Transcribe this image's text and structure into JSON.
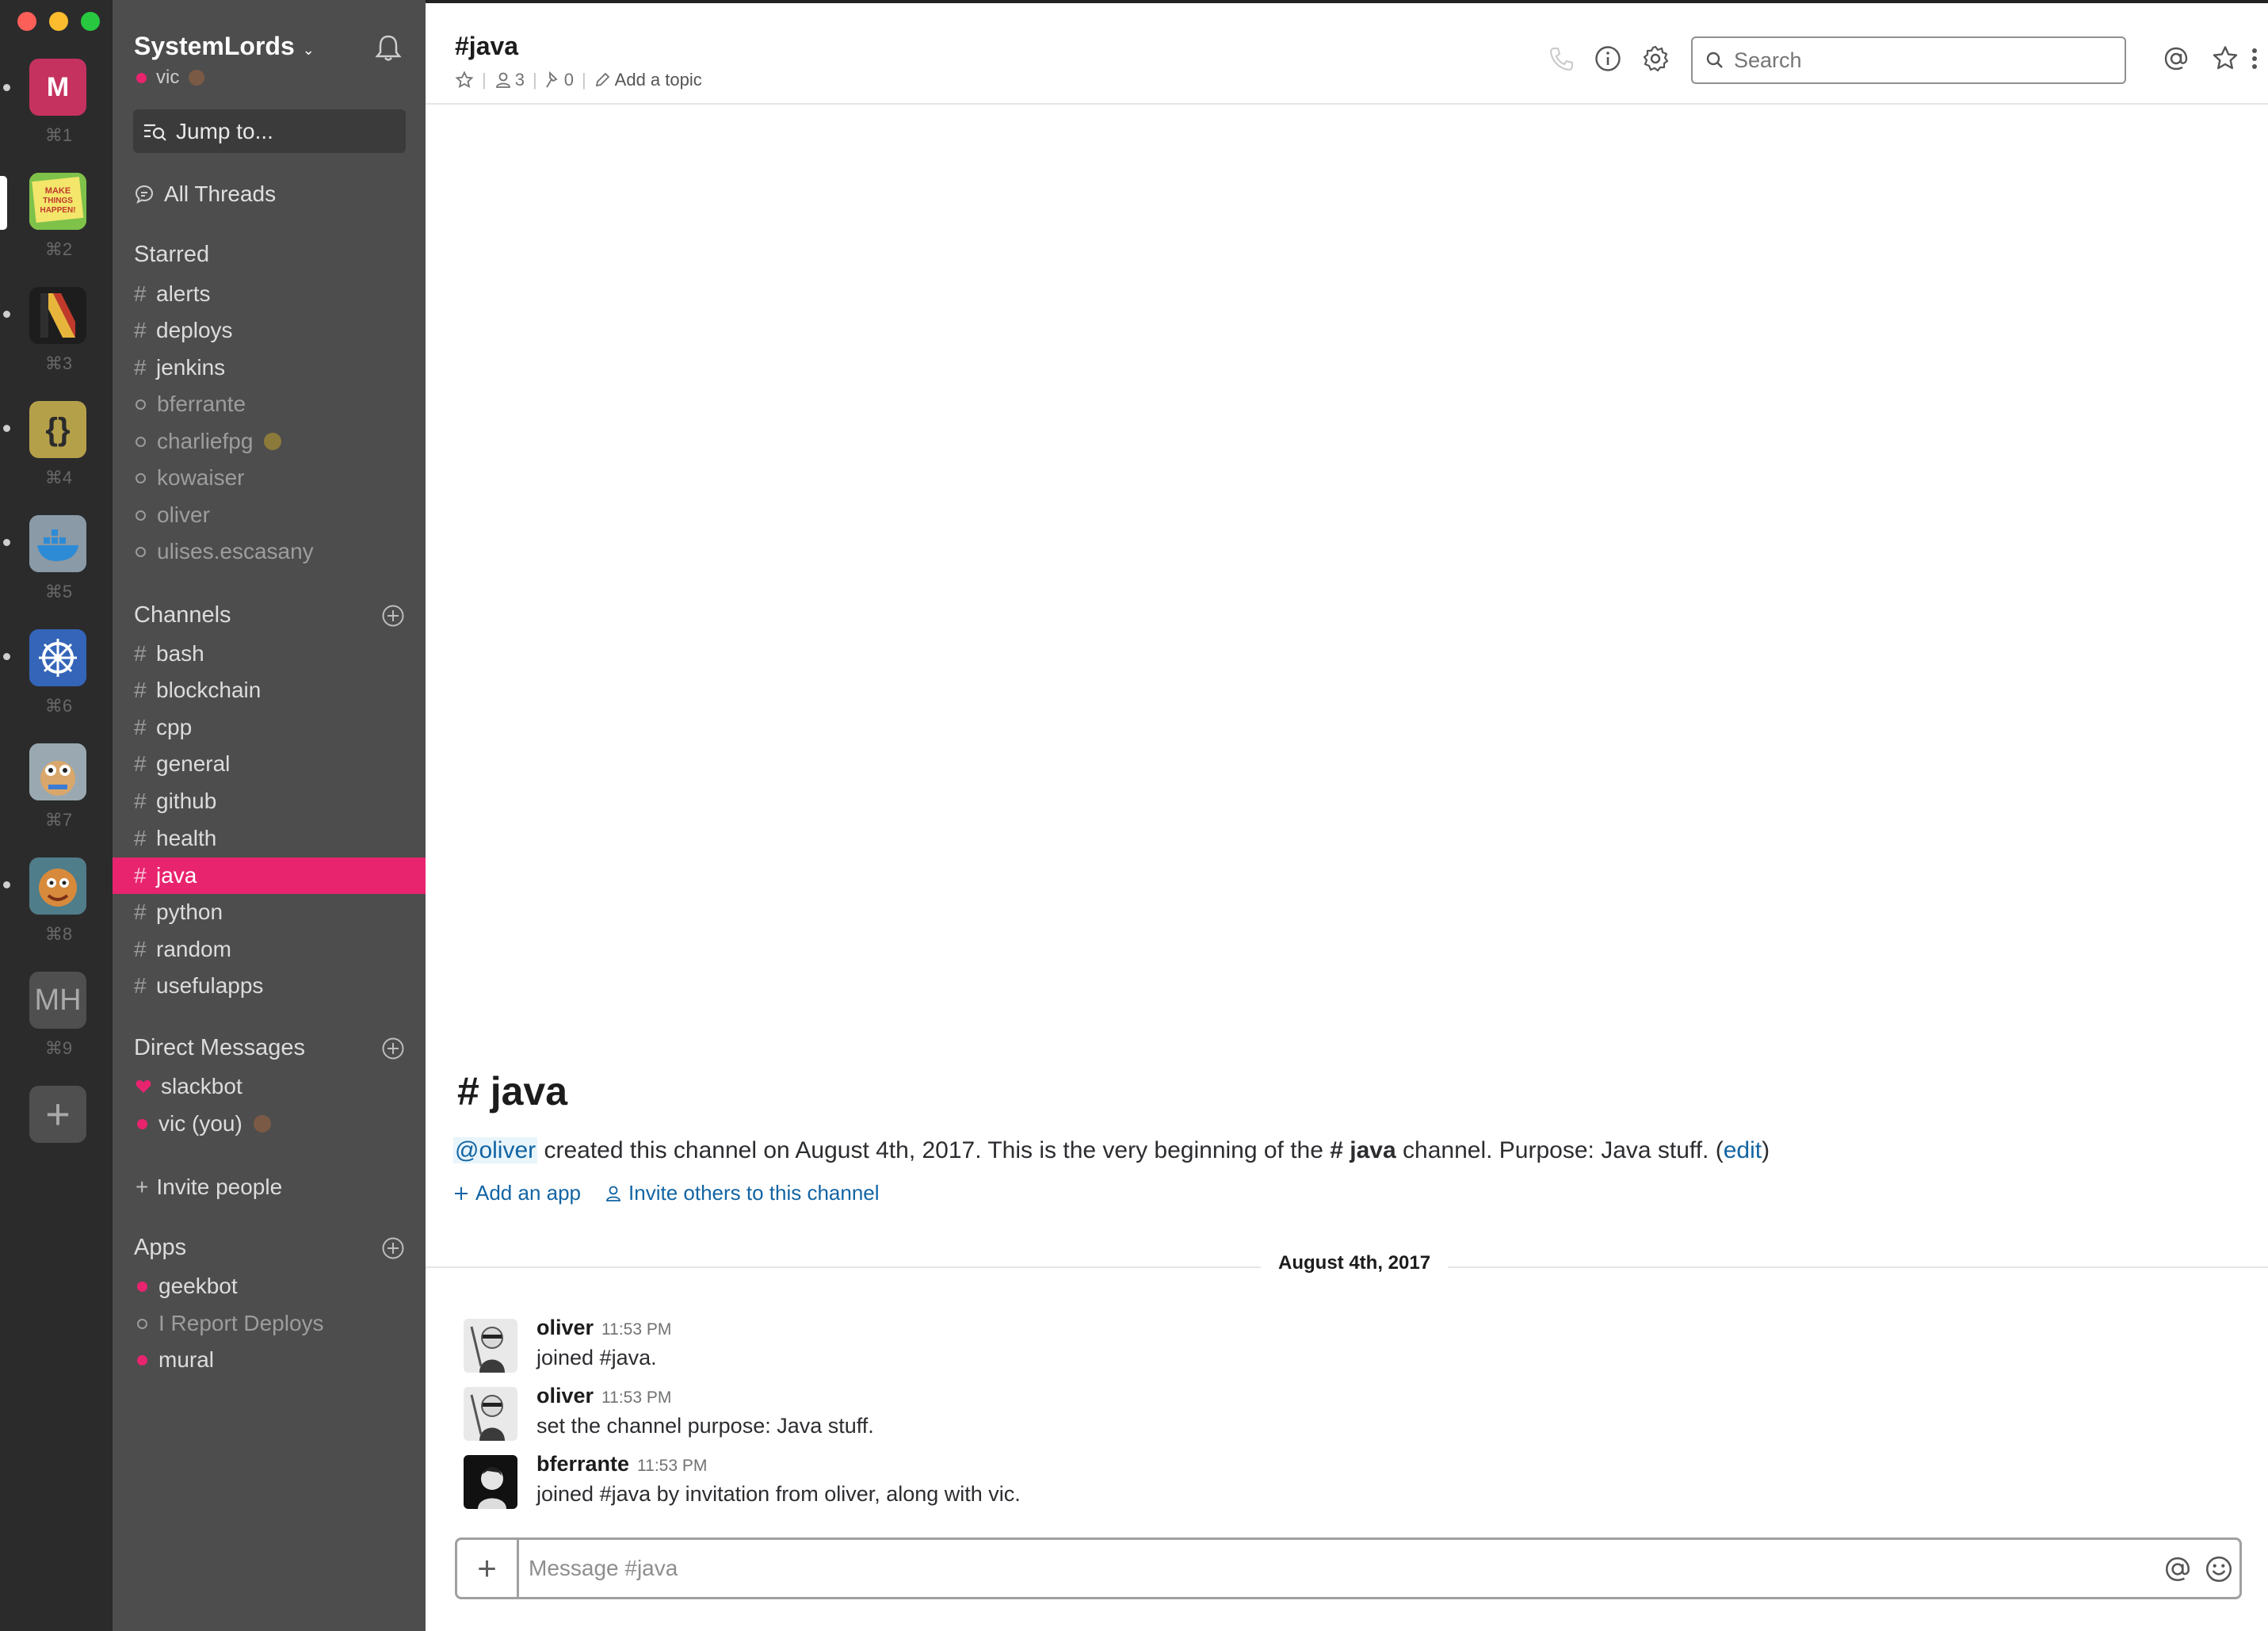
{
  "colors": {
    "accent": "#e8246f",
    "sidebar": "#4d4d4d",
    "teams_bar": "#2b2b2c",
    "link": "#1264a3"
  },
  "teams": [
    {
      "initials": "M",
      "key": "⌘1",
      "color": "#c6325f"
    },
    {
      "initials": "",
      "key": "⌘2",
      "color": "#e9d84a",
      "art": "make-things-happen"
    },
    {
      "initials": "",
      "key": "⌘3",
      "color": "#222",
      "art": "n-logo"
    },
    {
      "initials": "{}",
      "key": "⌘4",
      "color": "#b5a04a"
    },
    {
      "initials": "",
      "key": "⌘5",
      "color": "#7c8f9c",
      "art": "whale"
    },
    {
      "initials": "",
      "key": "⌘6",
      "color": "#3465b8",
      "art": "helm"
    },
    {
      "initials": "",
      "key": "⌘7",
      "color": "#8fa0a9",
      "art": "gopher"
    },
    {
      "initials": "",
      "key": "⌘8",
      "color": "#a26b3a",
      "art": "cartoon"
    },
    {
      "initials": "MH",
      "key": "⌘9",
      "color": "#4f4f50"
    }
  ],
  "add_team_label": "+",
  "sidebar": {
    "team_name": "SystemLords",
    "team_caret": "⌄",
    "username": "vic",
    "jump_to": "Jump to...",
    "all_threads": "All Threads",
    "starred": {
      "heading": "Starred",
      "channels": [
        "alerts",
        "deploys",
        "jenkins"
      ],
      "dms": [
        "bferrante",
        "charliefpg",
        "kowaiser",
        "oliver",
        "ulises.escasany"
      ]
    },
    "channels": {
      "heading": "Channels",
      "items": [
        "bash",
        "blockchain",
        "cpp",
        "general",
        "github",
        "health",
        "java",
        "python",
        "random",
        "usefulapps"
      ],
      "selected": "java"
    },
    "direct_messages": {
      "heading": "Direct Messages",
      "items": [
        "slackbot",
        "vic  (you)"
      ]
    },
    "invite": "Invite people",
    "apps": {
      "heading": "Apps",
      "items": [
        "geekbot",
        "I Report Deploys",
        "mural"
      ]
    }
  },
  "header": {
    "title": "#java",
    "members": "3",
    "pins": "0",
    "topic": "Add a topic",
    "search_placeholder": "Search"
  },
  "intro": {
    "title": "# java",
    "mention": "@oliver",
    "text_1": " created this channel on August 4th, 2017. This is the very beginning of the ",
    "channel": " # java",
    "text_2": " channel. Purpose: Java stuff. (",
    "edit": "edit",
    "text_3": ")",
    "add_app": "Add an app",
    "invite_others": "Invite others to this channel"
  },
  "day_divider": "August 4th, 2017",
  "messages": [
    {
      "name": "oliver",
      "time": "11:53 PM",
      "text": "joined #java."
    },
    {
      "name": "oliver",
      "time": "11:53 PM",
      "text": "set the channel purpose: Java stuff."
    },
    {
      "name": "bferrante",
      "time": "11:53 PM",
      "text": "joined #java by invitation from oliver, along with vic."
    }
  ],
  "composer": {
    "placeholder": "Message #java",
    "plus": "+"
  }
}
